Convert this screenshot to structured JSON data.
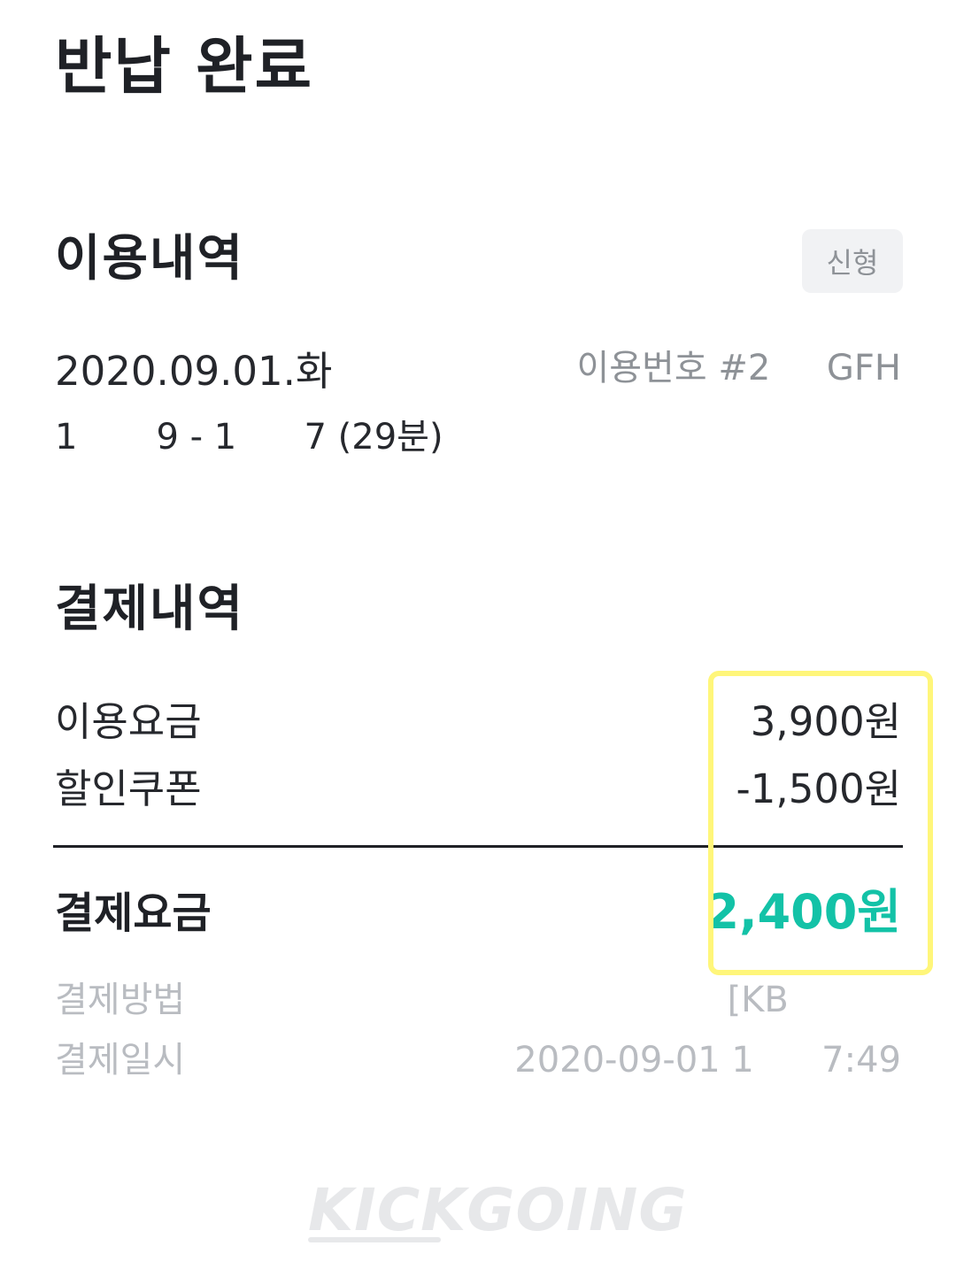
{
  "header": {
    "title": "반납 완료"
  },
  "usage": {
    "section_title": "이용내역",
    "model_badge": "신형",
    "date": "2020.09.01.화",
    "number": "이용번호 #2     GFH",
    "time_range": "1       9 - 1      7 (29분)"
  },
  "payment": {
    "section_title": "결제내역",
    "rows": [
      {
        "label": "이용요금",
        "value": "3,900원"
      },
      {
        "label": "할인쿠폰",
        "value": "-1,500원"
      }
    ],
    "total_label": "결제요금",
    "total_value": "2,400원",
    "method_label": "결제방법",
    "method_value": "[KB          ",
    "datetime_label": "결제일시",
    "datetime_value": "2020-09-01 1      7:49"
  },
  "brand": {
    "logo_text": "KICKGOING"
  },
  "colors": {
    "accent": "#13c2a7",
    "highlight": "#fff67a",
    "muted": "#b9bcc1",
    "badge_bg": "#f1f2f4"
  }
}
